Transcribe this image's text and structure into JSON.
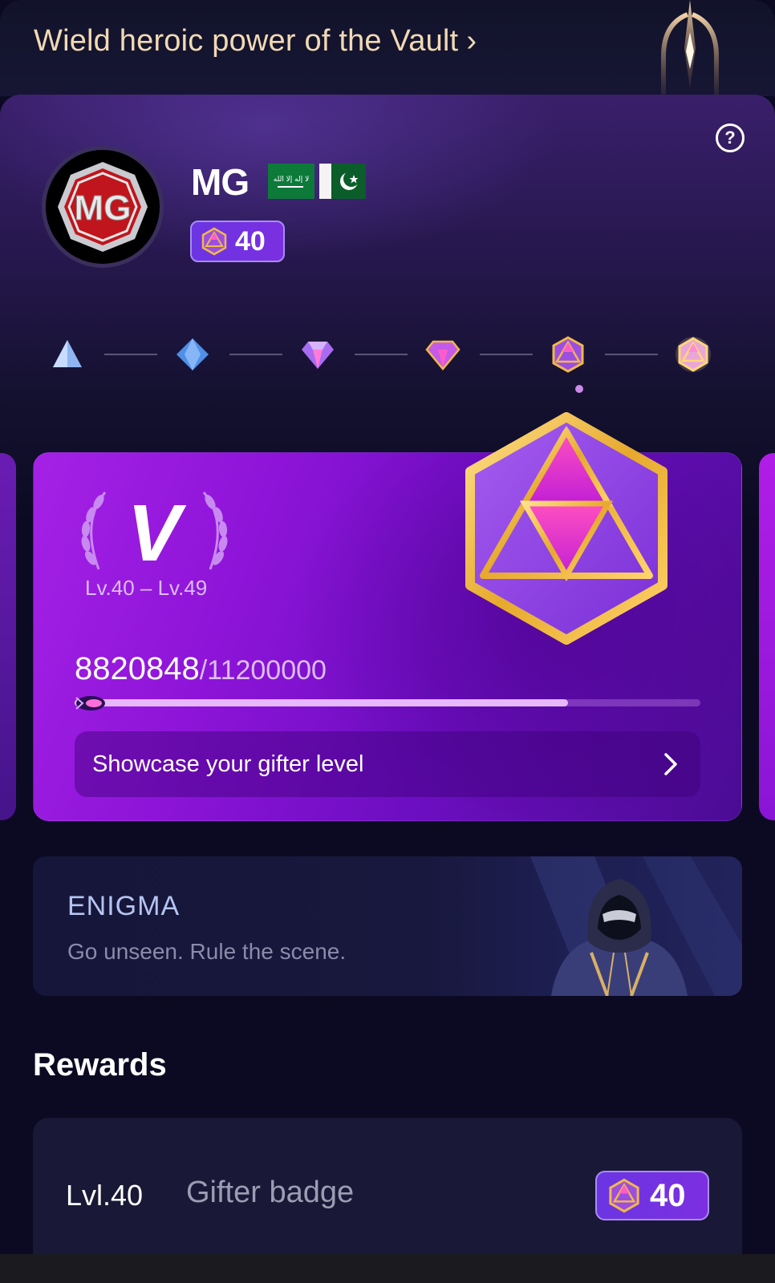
{
  "banner": {
    "text": "Wield heroic power of the Vault",
    "chevron": "›",
    "emblem_icon": "vault-trident-icon"
  },
  "profile": {
    "help_icon": "question-circle-icon",
    "help_glyph": "?",
    "avatar_icon": "mg-logo-avatar",
    "avatar_text": "MG",
    "name": "MG",
    "flags": [
      "saudi-arabia-flag-icon",
      "pakistan-flag-icon"
    ],
    "flag_sa_text": "لا إله إلا الله",
    "level_badge": {
      "icon": "gem-icosahedron-icon",
      "value": "40"
    }
  },
  "tiers": {
    "icons": [
      "tier-1-pyramid-icon",
      "tier-2-diamond-icon",
      "tier-3-gem-icon",
      "tier-4-gem-icon",
      "tier-5-icosahedron-icon",
      "tier-6-icosahedron-icon"
    ],
    "active_index": 4
  },
  "level_card": {
    "tier_letter": "V",
    "level_range": "Lv.40 – Lv.49",
    "progress_current": "8820848",
    "progress_total": "/11200000",
    "progress_fraction": 0.788,
    "showcase_label": "Showcase your gifter level",
    "showcase_icon": "chevron-right-icon"
  },
  "enigma": {
    "title": "ENIGMA",
    "subtitle": "Go unseen. Rule the scene.",
    "figure_icon": "masked-hooded-figure"
  },
  "rewards": {
    "heading": "Rewards",
    "items": [
      {
        "level": "Lvl.40",
        "name": "Gifter badge",
        "badge_value": "40",
        "badge_icon": "gem-icosahedron-icon"
      }
    ]
  },
  "colors": {
    "background": "#0b0a22",
    "banner_text": "#f1d9b3",
    "card_purple": "#8d14d8",
    "gold": "#e8b93a",
    "pill_purple": "#6b35e2"
  }
}
